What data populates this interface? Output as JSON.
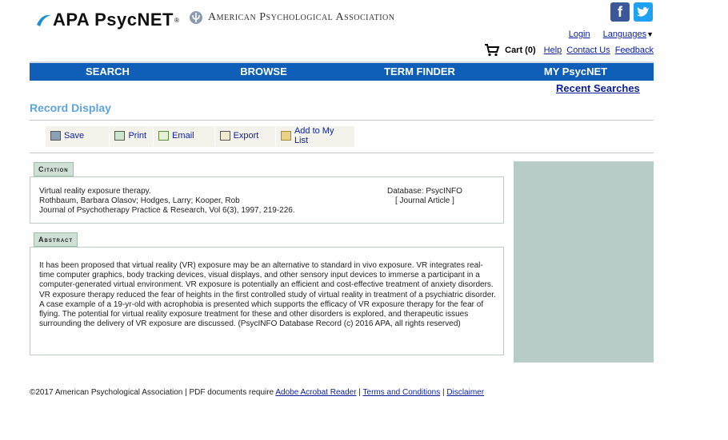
{
  "brand": {
    "logo_text": "APA PsycNET",
    "reg_mark": "®",
    "association": "American Psychological Association"
  },
  "social": {
    "facebook_glyph": "f",
    "twitter_glyph": "t"
  },
  "toplinks": {
    "login": "Login",
    "languages": "Languages"
  },
  "cart": {
    "label": "Cart (0)",
    "help": "Help",
    "contact": "Contact Us",
    "feedback": "Feedback"
  },
  "nav": {
    "search": "SEARCH",
    "browse": "BROWSE",
    "term_finder": "TERM FINDER",
    "my_psycnet": "MY PsycNET"
  },
  "recent_searches": "Recent Searches",
  "page_title": "Record Display",
  "toolbar": {
    "save": "Save",
    "print": "Print",
    "email": "Email",
    "export": "Export",
    "add": "Add to My List"
  },
  "citation": {
    "tab": "Citation",
    "title": "Virtual reality exposure therapy.",
    "authors": "Rothbaum, Barbara Olasov; Hodges, Larry; Kooper, Rob",
    "journal": "Journal of Psychotherapy Practice & Research, Vol 6(3), 1997, 219-226.",
    "database": "Database: PsycINFO",
    "doc_type": "[ Journal Article ]"
  },
  "abstract": {
    "tab": "Abstract",
    "text": "It has been proposed that virtual reality (VR) exposure may be an alternative to standard in vivo exposure. VR integrates real-time computer graphics, body tracking devices, visual displays, and other sensory input devices to immerse a participant in a computer-generated virtual environment. VR exposure is potentially an efficient and cost-effective treatment of anxiety disorders. VR exposure therapy reduced the fear of heights in the first controlled study of virtual reality in treatment of a psychiatric disorder. A case example of a 19-yr-old with acrophobia is presented which supports the efficacy of VR exposure therapy for the fear of flying. The potential for virtual reality exposure treatment for these and other disorders is explored, and therapeutic issues surrounding the delivery of VR exposure are discussed. (PsycINFO Database Record (c) 2016 APA, all rights reserved)"
  },
  "footer": {
    "copyright": "©2017 American Psychological Association | PDF documents require ",
    "acrobat": "Adobe Acrobat Reader",
    "sep1": " | ",
    "terms": "Terms and Conditions",
    "sep2": " | ",
    "disclaimer": "Disclaimer"
  },
  "colors": {
    "nav": "#0f5fb8",
    "title": "#5fa4d8",
    "sidebar": "#b8ccc7",
    "tab": "#cfe0d6"
  }
}
